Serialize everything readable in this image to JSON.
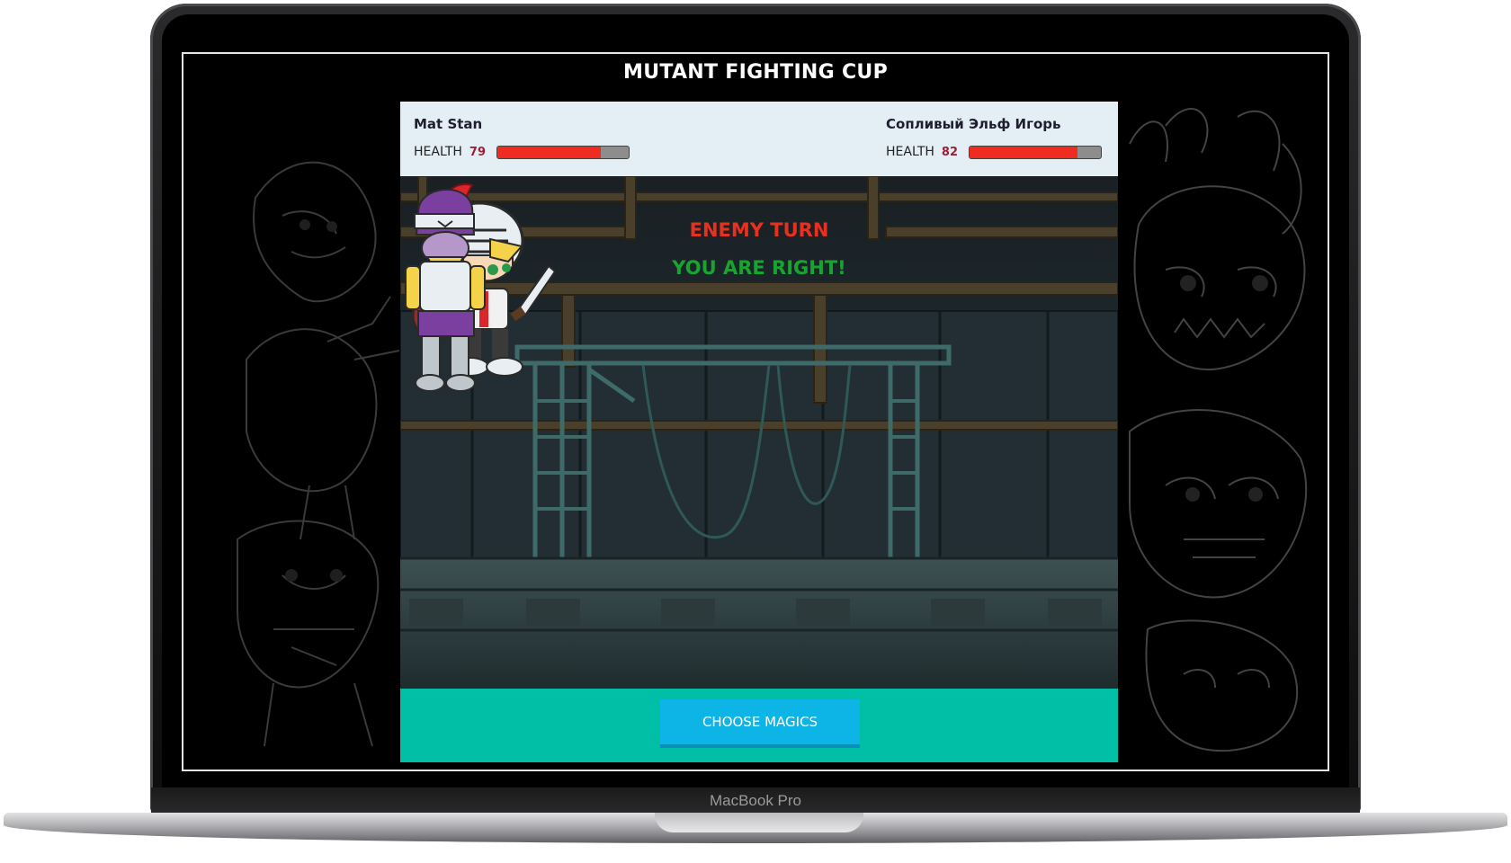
{
  "device": {
    "label": "MacBook Pro"
  },
  "page": {
    "title": "MUTANT FIGHTING CUP"
  },
  "player": {
    "name": "Mat Stan",
    "health_label": "HEALTH",
    "health": 79,
    "health_max": 100
  },
  "enemy": {
    "name": "Сопливый Эльф Игорь",
    "health_label": "HEALTH",
    "health": 82,
    "health_max": 100
  },
  "arena": {
    "turn_message": "ENEMY TURN",
    "answer_message": "YOU ARE RIGHT!"
  },
  "actions": {
    "choose_label": "CHOOSE MAGICS"
  },
  "colors": {
    "health_fill": "#ef2c1f",
    "turn_text": "#e8301f",
    "answer_text": "#18a42f",
    "action_bar": "#00bfa6",
    "button": "#0db4e6"
  }
}
